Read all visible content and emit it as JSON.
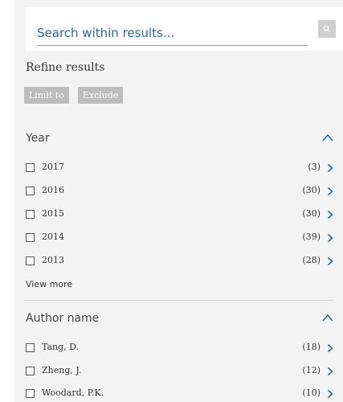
{
  "search": {
    "placeholder": "Search within results..."
  },
  "refine": {
    "title": "Refine results",
    "limit_label": "Limit to",
    "exclude_label": "Exclude"
  },
  "year": {
    "title": "Year",
    "items": [
      {
        "label": "2017",
        "count": "(3)"
      },
      {
        "label": "2016",
        "count": "(30)"
      },
      {
        "label": "2015",
        "count": "(30)"
      },
      {
        "label": "2014",
        "count": "(39)"
      },
      {
        "label": "2013",
        "count": "(28)"
      }
    ],
    "view_more": "View more"
  },
  "author": {
    "title": "Author name",
    "items": [
      {
        "label": "Tang, D.",
        "count": "(18)"
      },
      {
        "label": "Zheng, J.",
        "count": "(12)"
      },
      {
        "label": "Woodard, P.K.",
        "count": "(10)"
      }
    ]
  },
  "colors": {
    "accent": "#2a6a9e",
    "panel_bg": "#f3f3f3",
    "chip_bg": "#bdbdbd"
  },
  "icons": {
    "search": "search-icon",
    "collapse": "chevron-up-icon",
    "expand": "chevron-right-icon"
  }
}
